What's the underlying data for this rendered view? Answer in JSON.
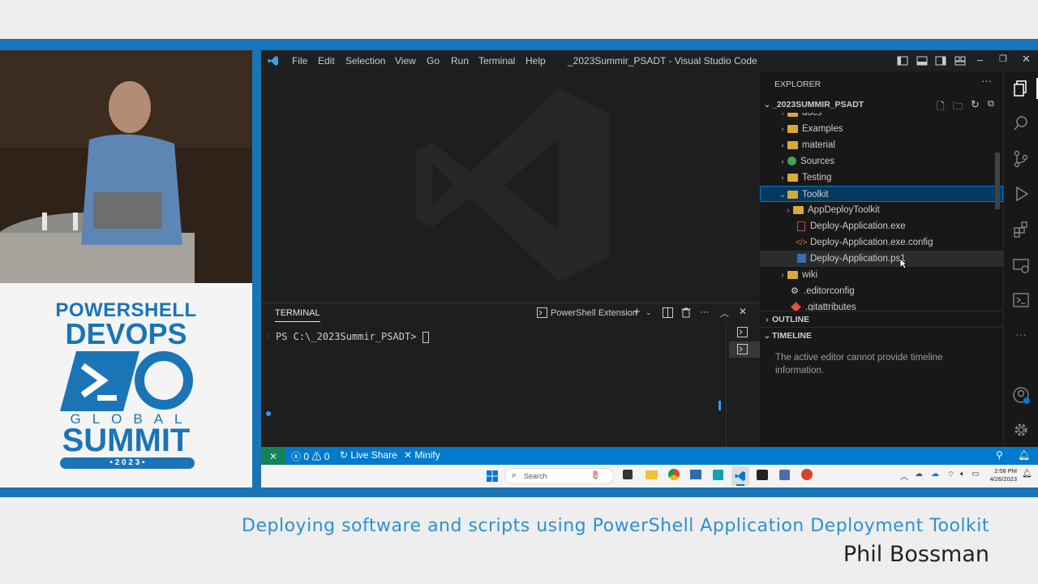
{
  "vscode": {
    "menu": [
      "File",
      "Edit",
      "Selection",
      "View",
      "Go",
      "Run",
      "Terminal",
      "Help"
    ],
    "window_title": "_2023Summir_PSADT - Visual Studio Code"
  },
  "explorer": {
    "header": "EXPLORER",
    "root": "_2023SUMMIR_PSADT",
    "items": [
      {
        "label": "docs",
        "type": "folder",
        "depth": 1
      },
      {
        "label": "Examples",
        "type": "folder",
        "depth": 1
      },
      {
        "label": "material",
        "type": "folder",
        "depth": 1
      },
      {
        "label": "Sources",
        "type": "folder-green",
        "depth": 1
      },
      {
        "label": "Testing",
        "type": "folder",
        "depth": 1
      },
      {
        "label": "Toolkit",
        "type": "folder-open",
        "depth": 1
      },
      {
        "label": "AppDeployToolkit",
        "type": "folder",
        "depth": 2
      },
      {
        "label": "Deploy-Application.exe",
        "type": "exe",
        "depth": 2
      },
      {
        "label": "Deploy-Application.exe.config",
        "type": "config",
        "depth": 2
      },
      {
        "label": "Deploy-Application.ps1",
        "type": "ps1",
        "depth": 2
      },
      {
        "label": "wiki",
        "type": "folder",
        "depth": 1
      },
      {
        "label": ".editorconfig",
        "type": "gear",
        "depth": 1
      },
      {
        "label": ".gitattributes",
        "type": "git",
        "depth": 1
      }
    ],
    "outline_label": "OUTLINE",
    "timeline_label": "TIMELINE",
    "timeline_message": "The active editor cannot provide timeline information."
  },
  "terminal": {
    "tab_label": "TERMINAL",
    "shell_label": "PowerShell Extension",
    "prompt": "PS C:\\_2023Summir_PSADT> "
  },
  "statusbar": {
    "errors": "0",
    "warnings": "0",
    "live_share": "Live Share",
    "minify": "Minify"
  },
  "taskbar": {
    "search_placeholder": "Search",
    "time": "2:08 PM",
    "date": "4/26/2023"
  },
  "event": {
    "line1": "POWERSHELL",
    "line2": "DEVOPS",
    "line3": "GLOBAL",
    "line4": "SUMMIT",
    "year": "• 2 0 2 3 •"
  },
  "caption": {
    "title": "Deploying software and scripts using PowerShell Application Deployment Toolkit",
    "speaker": "Phil Bossman"
  },
  "colors": {
    "accent_blue": "#1a75b6",
    "status_blue": "#007acc",
    "remote_green": "#16825d"
  }
}
